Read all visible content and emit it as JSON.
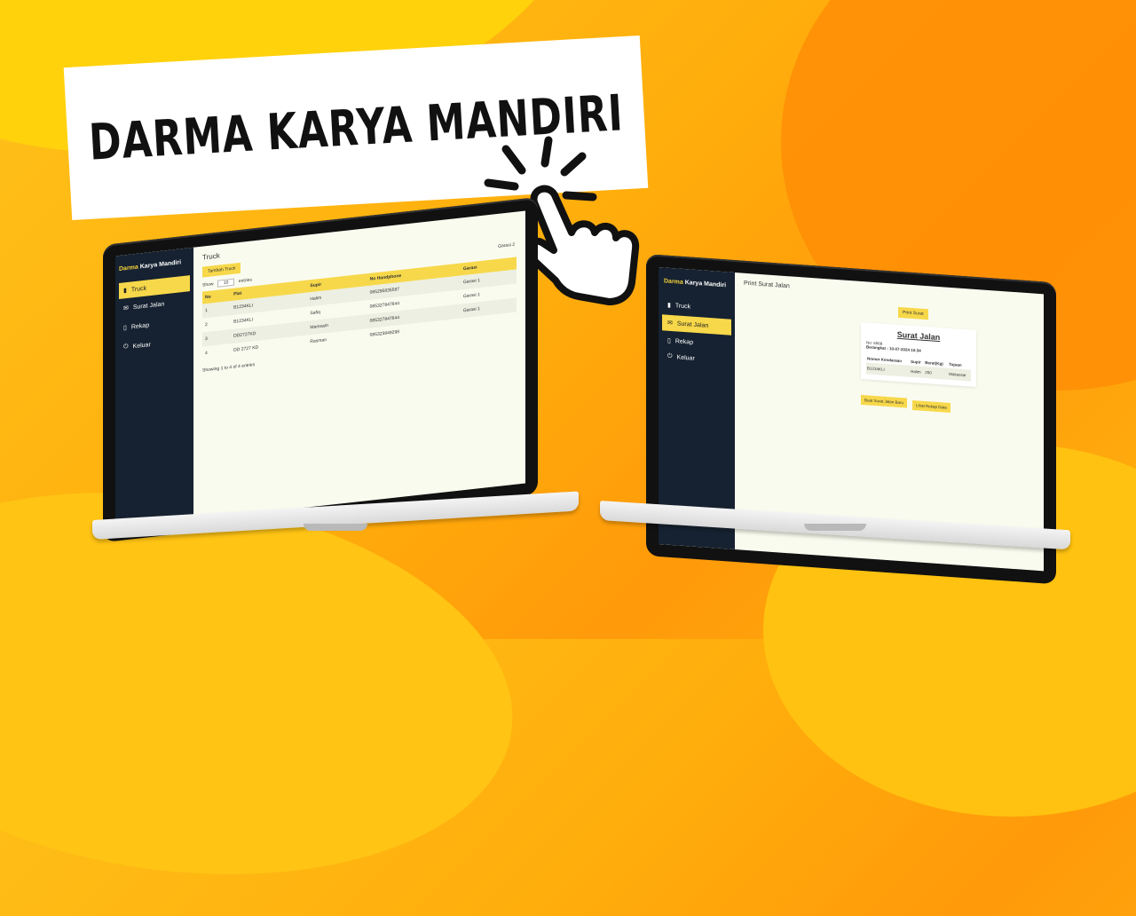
{
  "banner": {
    "title": "DARMA KARYA MANDIRI"
  },
  "brand": {
    "word1": "Darma",
    "word2": "Karya Mandiri"
  },
  "nav": [
    {
      "label": "Truck",
      "icon": "truck-icon"
    },
    {
      "label": "Surat Jalan",
      "icon": "envelope-icon"
    },
    {
      "label": "Rekap",
      "icon": "document-icon"
    },
    {
      "label": "Keluar",
      "icon": "power-icon"
    }
  ],
  "truck_page": {
    "title": "Truck",
    "add_button": "Tambah Truck",
    "show_label": "Show",
    "entries_value": "10",
    "entries_label": "entries",
    "columns": [
      "No",
      "Plat",
      "Supir",
      "No Handphone",
      "Garasi"
    ],
    "rows": [
      [
        "1",
        "B1234KLI",
        "Halim",
        "085295835587",
        "Garasi 1"
      ],
      [
        "2",
        "B1234KLI",
        "Safiq",
        "085327847644",
        "Garasi 1"
      ],
      [
        "3",
        "DD2727KD",
        "Mamsam",
        "085327847644",
        "Garasi 1"
      ],
      [
        "4",
        "DD 2727 KD",
        "Rasman",
        "085323849298",
        ""
      ]
    ],
    "footer": "Showing 1 to 4 of 4 entries",
    "header_extra": "Garasi 2"
  },
  "surat_page": {
    "title": "Print Surat Jalan",
    "print_button": "Print Surat",
    "doc_title": "Surat Jalan",
    "no_line": "No: 6568",
    "date_line": "Berangkat : 10-07-2024 10:34",
    "columns": [
      "Nomor Kendaraan",
      "Supir",
      "Berat(Kg)",
      "Tujuan"
    ],
    "row": [
      "B1234KLI",
      "Halim",
      "250",
      "Makassar"
    ],
    "new_button": "Buat Surat Jalan Baru",
    "rekap_button": "Lihat Rekap Data"
  },
  "colors": {
    "sidebar": "#162231",
    "accent": "#f7d84a",
    "content_bg": "#fafbef"
  }
}
